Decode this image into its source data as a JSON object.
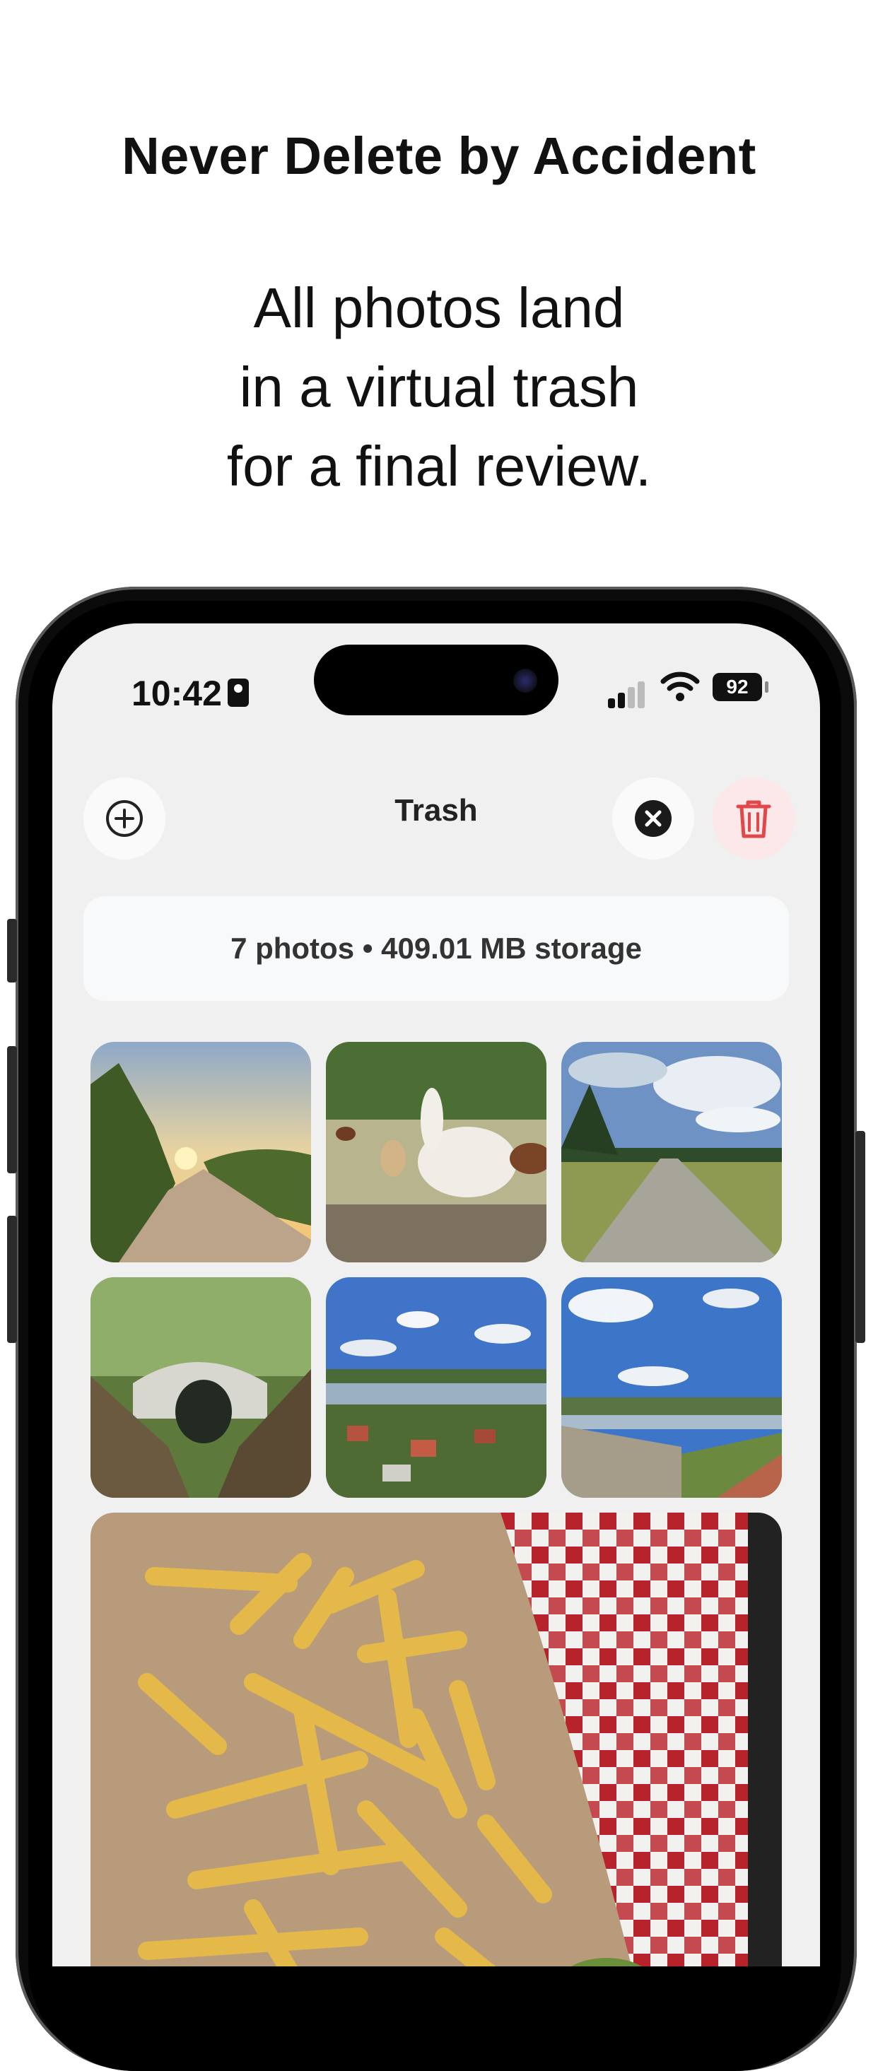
{
  "marketing": {
    "headline": "Never Delete by Accident",
    "sub_line_1": "All photos land",
    "sub_line_2": "in a virtual trash",
    "sub_line_3": "for a final review."
  },
  "status_bar": {
    "time": "10:42",
    "battery": "92"
  },
  "nav": {
    "title": "Trash",
    "add_icon": "plus-circle-icon",
    "close_icon": "close-circle-icon",
    "delete_icon": "trash-icon"
  },
  "summary": {
    "text": "7 photos • 409.01 MB storage"
  },
  "photos": [
    {
      "subject": "path at sunset"
    },
    {
      "subject": "alpacas in a field"
    },
    {
      "subject": "cobblestone road with clouds"
    },
    {
      "subject": "stone tunnel in forest ravine"
    },
    {
      "subject": "town by a river"
    },
    {
      "subject": "river view from castle wall"
    },
    {
      "subject": "fries on a checkered tablecloth"
    }
  ],
  "colors": {
    "screen_bg": "#f0f0f0",
    "delete_red": "#e0484a",
    "delete_bg": "#fce8e8"
  }
}
